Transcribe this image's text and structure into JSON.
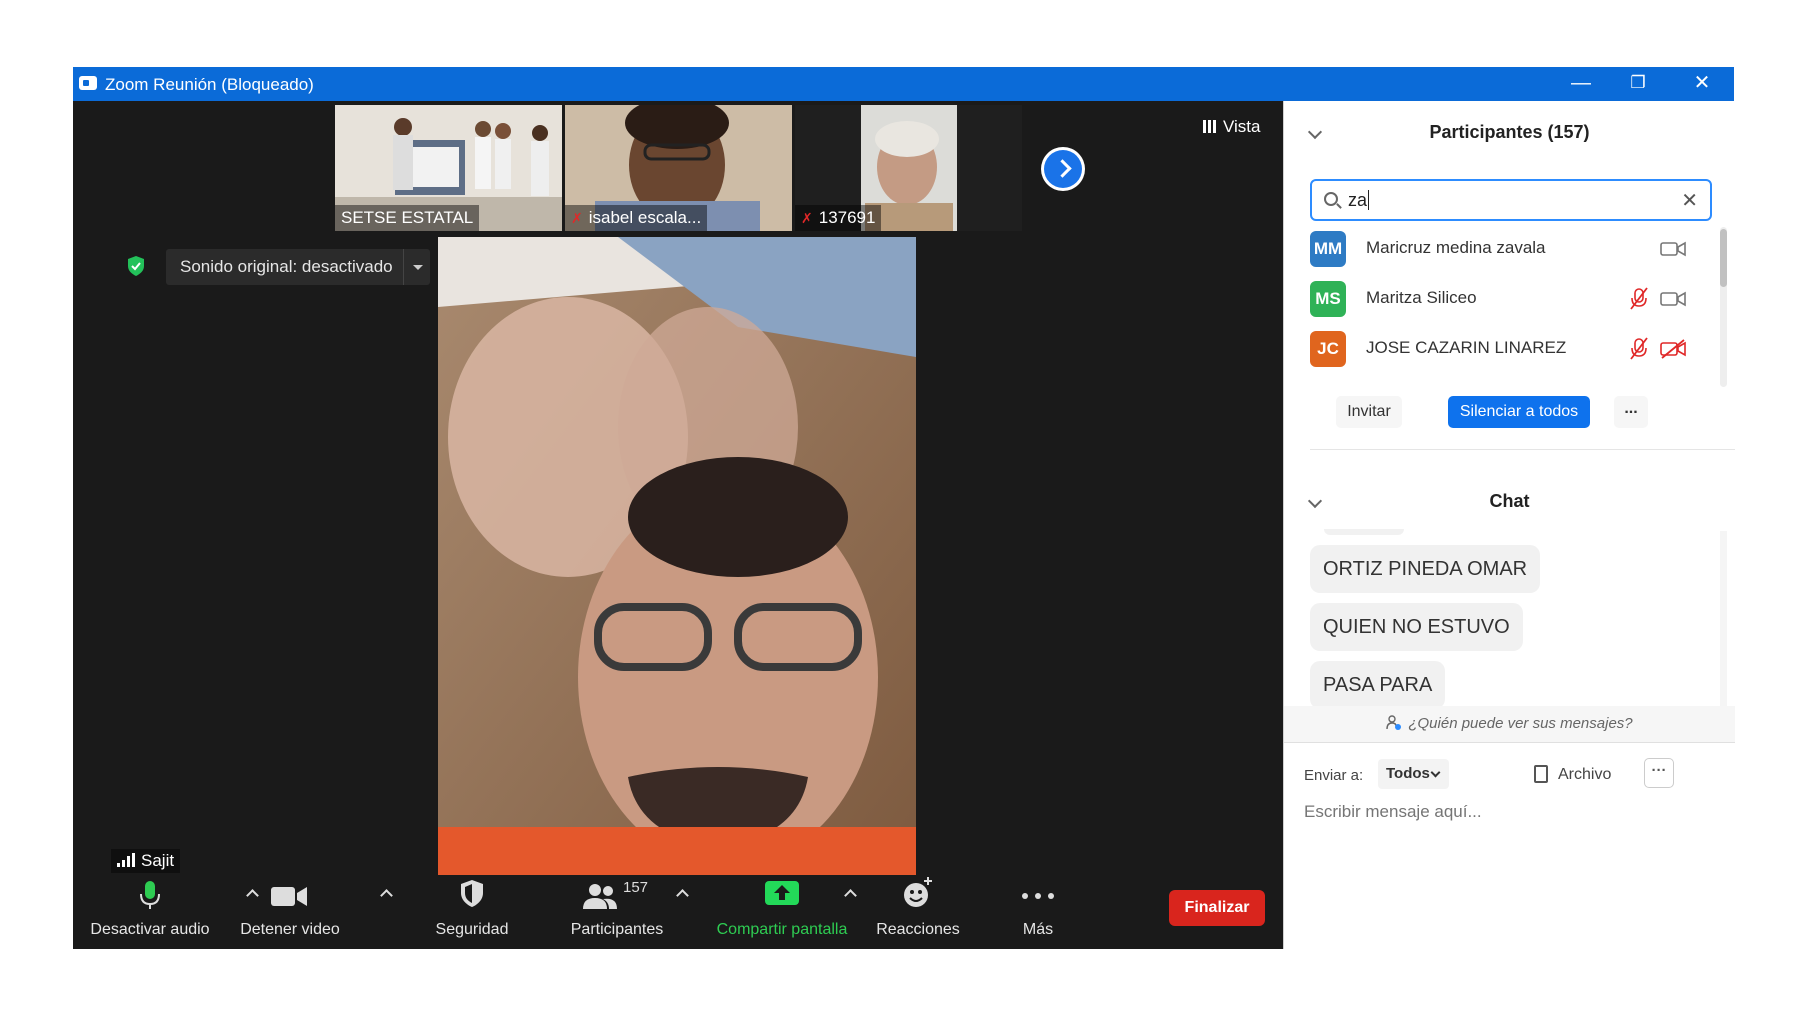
{
  "window": {
    "title": "Zoom Reunión (Bloqueado)",
    "minimize": "—",
    "maximize": "❐",
    "close": "✕"
  },
  "thumbnails": [
    {
      "name": "SETSE ESTATAL",
      "muted": false
    },
    {
      "name": "isabel escala...",
      "muted": true
    },
    {
      "name": "137691",
      "muted": true
    }
  ],
  "vista_label": "Vista",
  "sonido_label": "Sonido original: desactivado",
  "active_speaker": "Sajit",
  "toolbar": {
    "audio_label": "Desactivar audio",
    "video_label": "Detener video",
    "security_label": "Seguridad",
    "participants_label": "Participantes",
    "participants_count": "157",
    "share_label": "Compartir pantalla",
    "reactions_label": "Reacciones",
    "more_label": "Más",
    "end_label": "Finalizar"
  },
  "participants_panel": {
    "title": "Participantes (157)",
    "search_value": "za",
    "clear_icon": "✕",
    "items": [
      {
        "initials": "MM",
        "name": "Maricruz medina zavala",
        "color": "#2e7bc4",
        "mic_muted": false,
        "cam_off": false
      },
      {
        "initials": "MS",
        "name": "Maritza Siliceo",
        "color": "#2fb257",
        "mic_muted": true,
        "cam_off": false
      },
      {
        "initials": "JC",
        "name": "JOSE CAZARIN LINAREZ",
        "color": "#e0651e",
        "mic_muted": true,
        "cam_off": true
      }
    ],
    "invite_label": "Invitar",
    "mute_all_label": "Silenciar a todos",
    "more_label": "..."
  },
  "chat": {
    "title": "Chat",
    "messages": [
      "ORTIZ PINEDA OMAR",
      "QUIEN NO ESTUVO",
      "PASA PARA"
    ],
    "who_can_see": "¿Quién puede ver sus mensajes?",
    "send_to_label": "Enviar a:",
    "recipient": "Todos",
    "file_label": "Archivo",
    "more_label": "···",
    "input_placeholder": "Escribir mensaje aquí..."
  },
  "colors": {
    "titlebar": "#0b6bd8",
    "accent": "#0e72ed",
    "end": "#d9251d",
    "share": "#23d959",
    "mute_red": "#e02828"
  }
}
